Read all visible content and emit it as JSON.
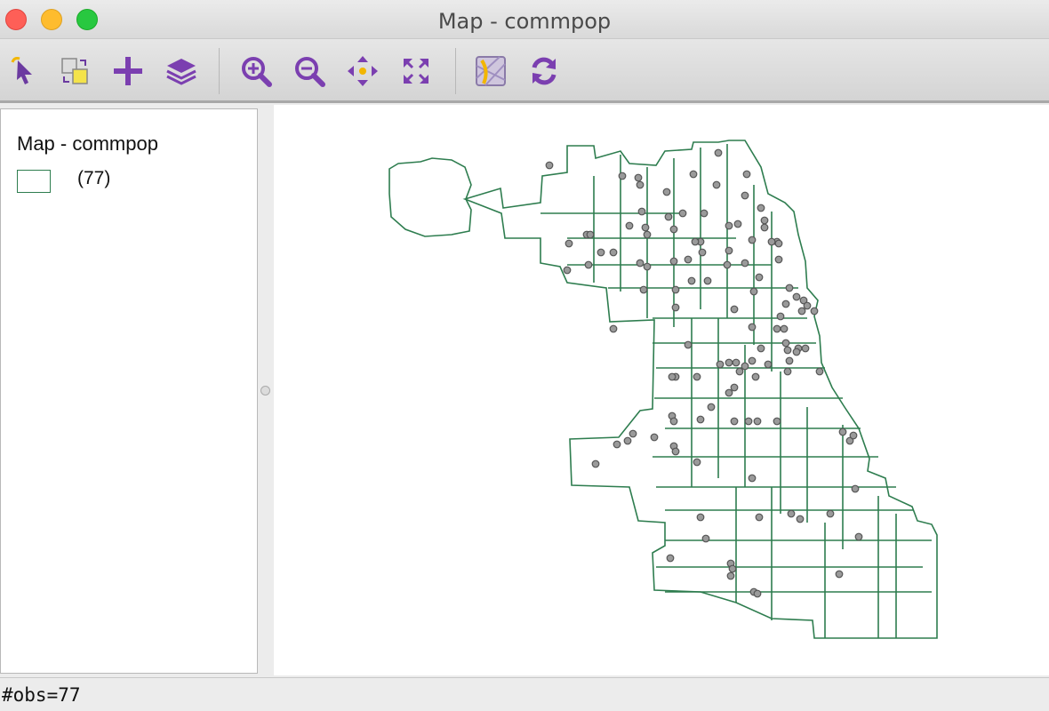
{
  "window": {
    "title": "Map - commpop"
  },
  "toolbar": {
    "buttons": [
      {
        "name": "select-tool",
        "icon": "select-arrow-icon"
      },
      {
        "name": "toggle-selection",
        "icon": "swap-selection-icon"
      },
      {
        "name": "add-layer",
        "icon": "plus-icon"
      },
      {
        "name": "layers",
        "icon": "layers-icon"
      },
      {
        "name": "zoom-in",
        "icon": "zoom-in-icon"
      },
      {
        "name": "zoom-out",
        "icon": "zoom-out-icon"
      },
      {
        "name": "pan",
        "icon": "pan-arrows-icon"
      },
      {
        "name": "fit-extent",
        "icon": "fit-extent-icon"
      },
      {
        "name": "basemap",
        "icon": "basemap-icon"
      },
      {
        "name": "refresh",
        "icon": "refresh-icon"
      }
    ],
    "accent": "#7b3fb0"
  },
  "legend": {
    "title": "Map - commpop",
    "items": [
      {
        "label": "(77)",
        "outline_color": "#2e7d4f"
      }
    ]
  },
  "map": {
    "layer": "commpop",
    "outline_color": "#2e7d4f",
    "point_fill": "#9a9a9a",
    "point_stroke": "#555555"
  },
  "status": {
    "text": "#obs=77"
  }
}
